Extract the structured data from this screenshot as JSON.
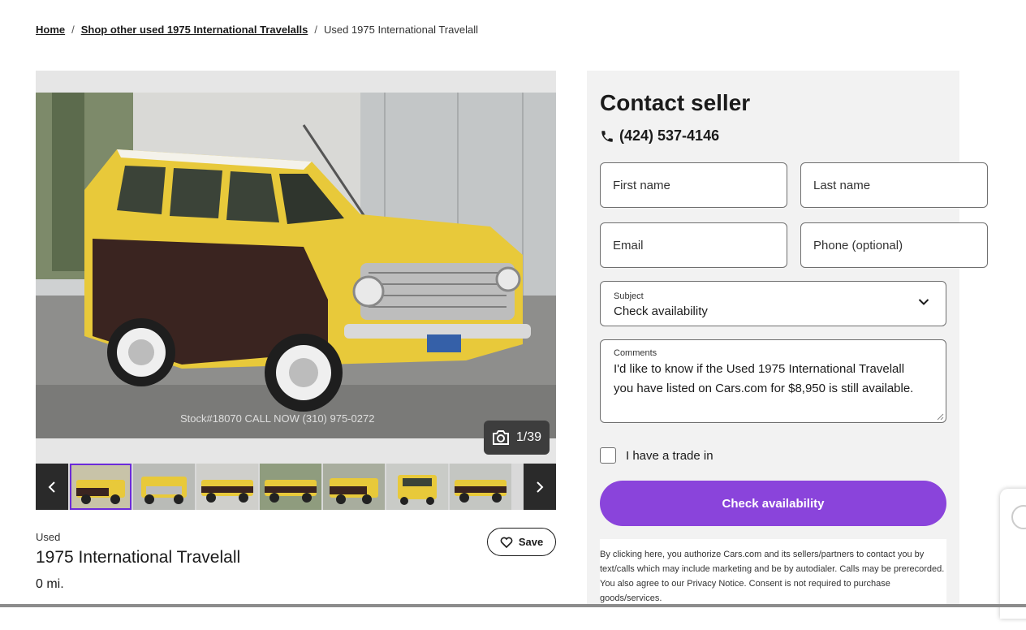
{
  "breadcrumb": {
    "home": "Home",
    "shop_link": "Shop other used 1975 International Travelalls",
    "current": "Used 1975 International Travelall",
    "separator": "/"
  },
  "gallery": {
    "counter": "1/39",
    "watermark": "Stock#18070 CALL NOW (310) 975-0272",
    "thumbnail_count": 7
  },
  "listing": {
    "condition": "Used",
    "title": "1975 International Travelall",
    "mileage": "0 mi.",
    "save_label": "Save"
  },
  "contact": {
    "heading": "Contact seller",
    "phone": "(424) 537-4146",
    "first_name_placeholder": "First name",
    "last_name_placeholder": "Last name",
    "email_placeholder": "Email",
    "phone_placeholder": "Phone (optional)",
    "subject_label": "Subject",
    "subject_value": "Check availability",
    "comments_label": "Comments",
    "comments_line1": "I'd like to know if the Used 1975 International Travelall",
    "comments_line2": "you have listed on Cars.com for $8,950 is still available.",
    "trade_in_label": "I have a trade in",
    "cta_label": "Check availability",
    "disclaimer": "By clicking here, you authorize Cars.com and its sellers/partners to contact you by text/calls which may include marketing and be by autodialer. Calls may be prerecorded. You also agree to our Privacy Notice. Consent is not required to purchase goods/services."
  },
  "colors": {
    "accent": "#8a44db",
    "panel_bg": "#f2f2f2",
    "car_yellow": "#e8c93a",
    "car_brown": "#3a2420"
  }
}
